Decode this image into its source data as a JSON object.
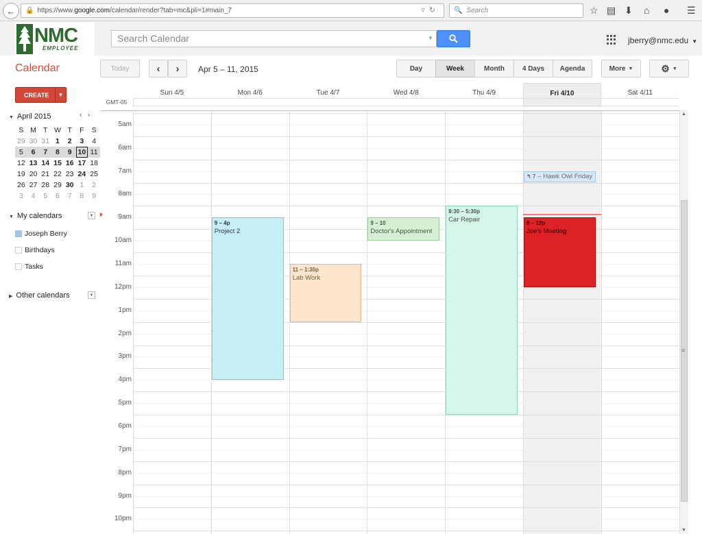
{
  "browser": {
    "url_prefix": "https://www.",
    "url_domain": "google.com",
    "url_rest": "/calendar/render?tab=mc&pli=1#main_7",
    "search_placeholder": "Search"
  },
  "header": {
    "logo_text": "NMC",
    "logo_sub": "EMPLOYEE",
    "search_placeholder": "Search Calendar",
    "user_email": "jberry@nmc.edu"
  },
  "toolbar": {
    "title": "Calendar",
    "today": "Today",
    "date_range": "Apr 5 – 11, 2015",
    "views": [
      "Day",
      "Week",
      "Month",
      "4 Days",
      "Agenda"
    ],
    "more": "More"
  },
  "sidebar": {
    "create": "CREATE",
    "mini_title": "April 2015",
    "weekdays": [
      "S",
      "M",
      "T",
      "W",
      "T",
      "F",
      "S"
    ],
    "weeks": [
      [
        {
          "d": "29",
          "o": true
        },
        {
          "d": "30",
          "o": true
        },
        {
          "d": "31",
          "o": true
        },
        {
          "d": "1",
          "b": true
        },
        {
          "d": "2",
          "b": true
        },
        {
          "d": "3",
          "b": true
        },
        {
          "d": "4"
        }
      ],
      [
        {
          "d": "5"
        },
        {
          "d": "6",
          "b": true
        },
        {
          "d": "7",
          "b": true
        },
        {
          "d": "8",
          "b": true
        },
        {
          "d": "9",
          "b": true
        },
        {
          "d": "10",
          "b": true,
          "today": true
        },
        {
          "d": "11"
        }
      ],
      [
        {
          "d": "12"
        },
        {
          "d": "13",
          "b": true
        },
        {
          "d": "14",
          "b": true
        },
        {
          "d": "15",
          "b": true
        },
        {
          "d": "16",
          "b": true
        },
        {
          "d": "17",
          "b": true
        },
        {
          "d": "18"
        }
      ],
      [
        {
          "d": "19"
        },
        {
          "d": "20"
        },
        {
          "d": "21"
        },
        {
          "d": "22"
        },
        {
          "d": "23"
        },
        {
          "d": "24",
          "b": true
        },
        {
          "d": "25"
        }
      ],
      [
        {
          "d": "26"
        },
        {
          "d": "27"
        },
        {
          "d": "28"
        },
        {
          "d": "29"
        },
        {
          "d": "30",
          "b": true
        },
        {
          "d": "1",
          "o": true
        },
        {
          "d": "2",
          "o": true
        }
      ],
      [
        {
          "d": "3",
          "o": true
        },
        {
          "d": "4",
          "o": true
        },
        {
          "d": "5",
          "o": true
        },
        {
          "d": "6",
          "o": true
        },
        {
          "d": "7",
          "o": true
        },
        {
          "d": "8",
          "o": true
        },
        {
          "d": "9",
          "o": true
        }
      ]
    ],
    "my_calendars_title": "My calendars",
    "my_calendars": [
      {
        "name": "Joseph Berry",
        "color": "#9fc6e7"
      },
      {
        "name": "Birthdays",
        "color": "#ffffff"
      },
      {
        "name": "Tasks",
        "color": "#ffffff"
      }
    ],
    "other_calendars_title": "Other calendars"
  },
  "grid": {
    "timezone": "GMT-05",
    "days": [
      "Sun 4/5",
      "Mon 4/6",
      "Tue 4/7",
      "Wed 4/8",
      "Thu 4/9",
      "Fri 4/10",
      "Sat 4/11"
    ],
    "selected_day": 5,
    "hours": [
      "5am",
      "6am",
      "7am",
      "8am",
      "9am",
      "10am",
      "11am",
      "12pm",
      "1pm",
      "2pm",
      "3pm",
      "4pm",
      "5pm",
      "6pm",
      "7pm",
      "8pm",
      "9pm",
      "10pm"
    ],
    "first_hour": 5,
    "now_hour": 8.85,
    "events": [
      {
        "day": 1,
        "start": 9,
        "end": 16,
        "time": "9 – 4p",
        "title": "Project 2",
        "bg": "#c5eff5",
        "border": "#7fc6d4",
        "color": "#335"
      },
      {
        "day": 2,
        "start": 11,
        "end": 13.5,
        "time": "11 – 1:30p",
        "title": "Lab Work",
        "bg": "#fde5cc",
        "border": "#e7b98c",
        "color": "#664"
      },
      {
        "day": 3,
        "start": 9,
        "end": 10,
        "time": "9 – 10",
        "title": "Doctor's Appointment",
        "bg": "#d5efd5",
        "border": "#9ccc9c",
        "color": "#454"
      },
      {
        "day": 4,
        "start": 8.5,
        "end": 17.5,
        "time": "8:30 – 5:30p",
        "title": "Car Repair",
        "bg": "#d5f5ea",
        "border": "#8fd3b9",
        "color": "#454"
      },
      {
        "day": 5,
        "start": 9,
        "end": 12,
        "time": "9 – 12p",
        "title": "Joe's Meeting",
        "bg": "#dc2127",
        "border": "#a31014",
        "color": "#1a0000"
      },
      {
        "day": 5,
        "start": 7,
        "end": 7.5,
        "time": "↰ 7",
        "title": "– Hawk Owl Friday",
        "bg": "#d8e8f5",
        "border": "#9fc6e7",
        "color": "#667",
        "inline": true
      }
    ]
  }
}
